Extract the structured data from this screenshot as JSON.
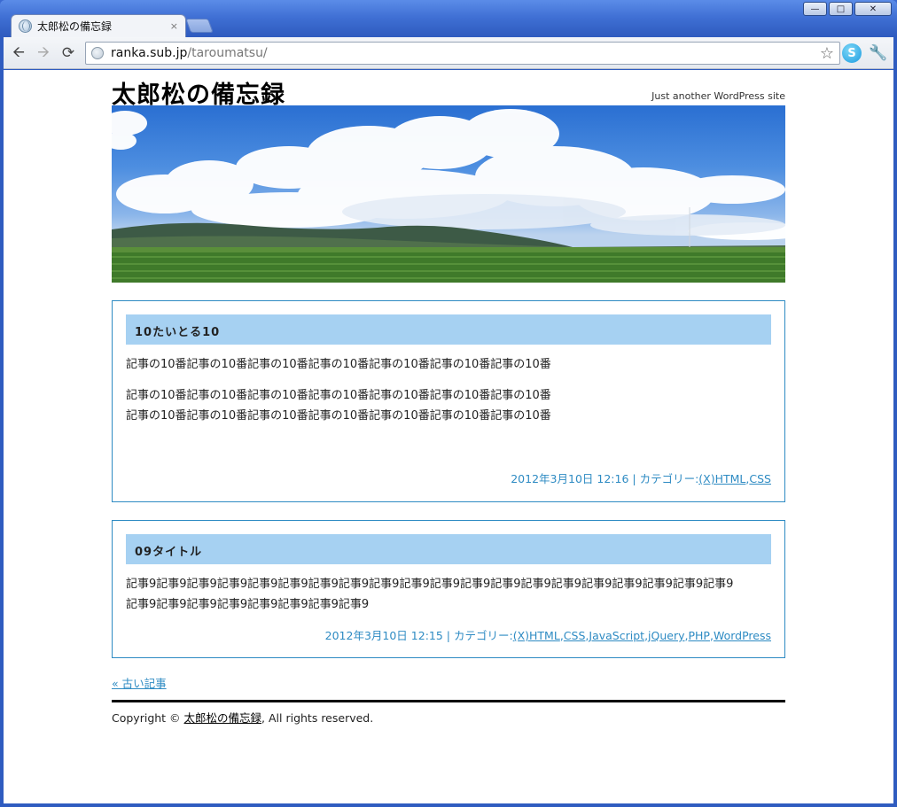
{
  "browser": {
    "tab_title": "太郎松の備忘録",
    "tab_close": "×",
    "url_host": "ranka.sub.jp",
    "url_path": "/taroumatsu/"
  },
  "window_controls": {
    "minimize": "—",
    "maximize": "□",
    "close": "✕"
  },
  "site": {
    "title": "太郎松の備忘録",
    "tagline": "Just another WordPress site"
  },
  "posts": [
    {
      "title": "10たいとる10",
      "paragraphs": [
        [
          "記事の10番記事の10番記事の10番記事の10番記事の10番記事の10番記事の10番"
        ],
        [
          "記事の10番記事の10番記事の10番記事の10番記事の10番記事の10番記事の10番",
          "記事の10番記事の10番記事の10番記事の10番記事の10番記事の10番記事の10番"
        ]
      ],
      "date": "2012年3月10日 12:16",
      "category_label": "カテゴリー:",
      "categories": [
        "(X)HTML",
        "CSS"
      ]
    },
    {
      "title": "09タイトル",
      "paragraphs": [
        [
          "記事9記事9記事9記事9記事9記事9記事9記事9記事9記事9記事9記事9記事9記事9記事9記事9記事9記事9記事9記事9",
          "記事9記事9記事9記事9記事9記事9記事9記事9"
        ]
      ],
      "date": "2012年3月10日 12:15",
      "category_label": "カテゴリー:",
      "categories": [
        "(X)HTML",
        "CSS",
        "JavaScript",
        "jQuery",
        "PHP",
        "WordPress"
      ]
    }
  ],
  "nav": {
    "older_posts": "« 古い記事"
  },
  "footer": {
    "prefix": "Copyright © ",
    "site_link": "太郎松の備忘録",
    "suffix": ", All rights reserved."
  }
}
